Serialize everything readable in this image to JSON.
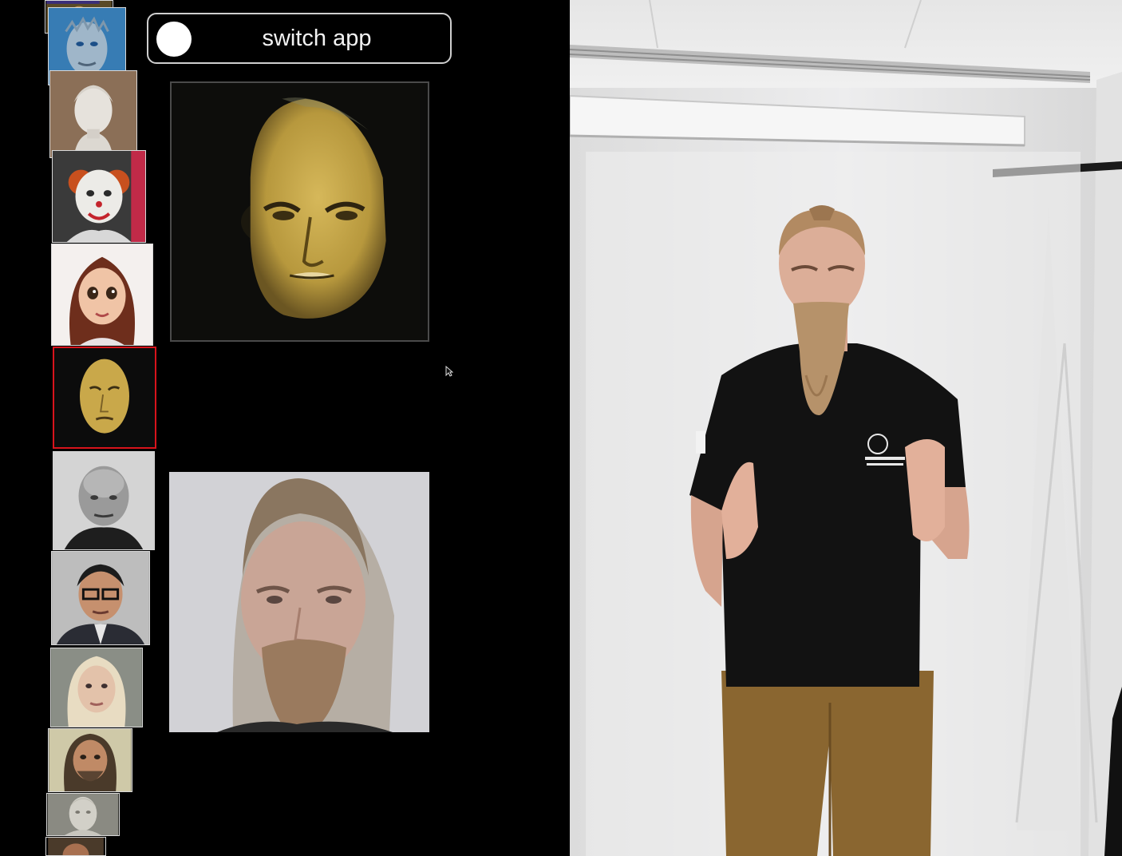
{
  "switch_app": {
    "label": "switch app"
  },
  "thumbnails": [
    "mona-lisa-thumbnail",
    "night-king-thumbnail",
    "marble-bust-thumbnail",
    "clown-thumbnail",
    "doll-thumbnail",
    "golden-mask-thumbnail",
    "churchill-thumbnail",
    "glasses-man-thumbnail",
    "blonde-woman-thumbnail",
    "bearded-man-thumbnail",
    "statue-thumbnail",
    "partial-thumbnail"
  ],
  "selected_thumbnail": "golden-mask-thumbnail",
  "colors": {
    "background": "#000000",
    "selection_border": "#d8141c",
    "switch_border": "#cfcfcf",
    "knob": "#ffffff",
    "mask_gold": "#c9a84a",
    "shirt": "#111111",
    "pants": "#8a6630",
    "studio_wall": "#e9eaeb"
  }
}
